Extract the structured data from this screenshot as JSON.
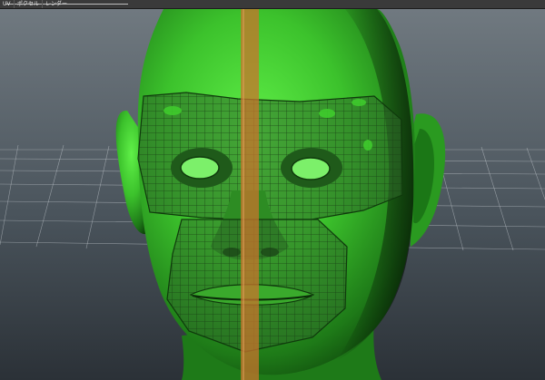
{
  "menubar": {
    "items": [
      "UV",
      "ポクセル",
      "レンダー"
    ]
  },
  "colors": {
    "viewport_top": "#6f7880",
    "viewport_bottom": "#2b3137",
    "skin_light": "#4fe63b",
    "skin_dark": "#0d4a0b",
    "mesh_overlay": "#2f6a2a",
    "center_seam": "#b86a2a",
    "grid": "#c9cfd6"
  },
  "icons": [
    "face-mesh-icon"
  ]
}
